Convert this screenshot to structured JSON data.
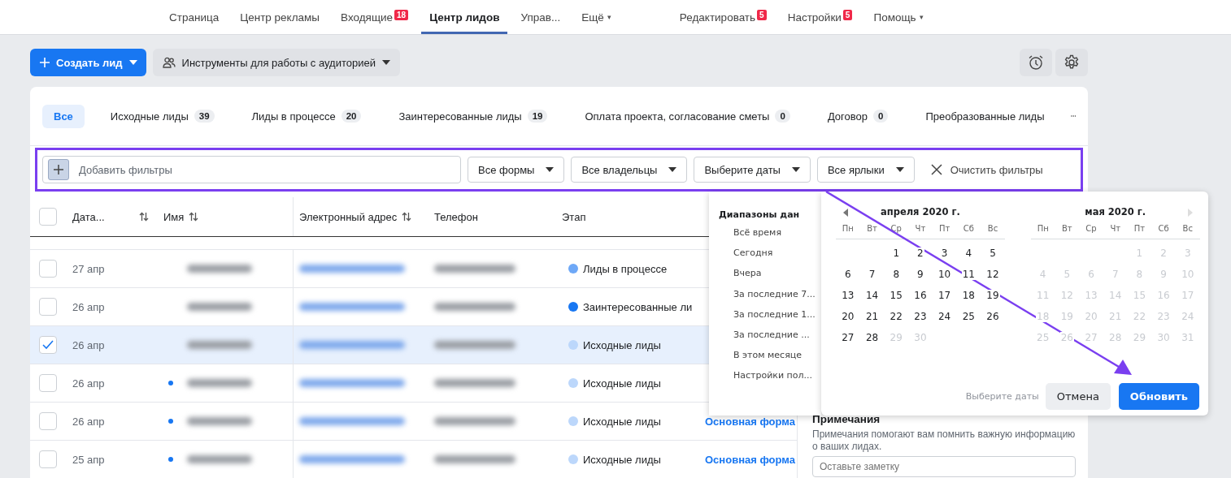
{
  "nav": {
    "left": [
      {
        "label": "Страница",
        "selected": false
      },
      {
        "label": "Центр рекламы",
        "selected": false
      },
      {
        "label": "Входящие",
        "badge": "18",
        "selected": false
      },
      {
        "label": "Центр лидов",
        "selected": true
      },
      {
        "label": "Управ...",
        "selected": false
      },
      {
        "label": "Ещё",
        "caret": "▾",
        "selected": false
      }
    ],
    "right": [
      {
        "label": "Редактировать",
        "badge": "5",
        "selected": false
      },
      {
        "label": "Настройки",
        "badge": "5",
        "selected": false
      },
      {
        "label": "Помощь",
        "caret": "▾",
        "selected": false
      }
    ]
  },
  "toolbar": {
    "create_button": "Создать лид",
    "audience_button": "Инструменты для работы с аудиторией"
  },
  "tabs": [
    {
      "label": "Все",
      "selected": true
    },
    {
      "label": "Исходные лиды",
      "count": "39",
      "selected": false
    },
    {
      "label": "Лиды в процессе",
      "count": "20",
      "selected": false
    },
    {
      "label": "Заинтересованные лиды",
      "count": "19",
      "selected": false
    },
    {
      "label": "Оплата проекта, согласование сметы",
      "count": "0",
      "selected": false
    },
    {
      "label": "Договор",
      "count": "0",
      "selected": false
    },
    {
      "label": "Преобразованные лиды",
      "selected": false
    }
  ],
  "filters": {
    "placeholder": "Добавить фильтры",
    "dropdowns": [
      "Все формы",
      "Все владельцы",
      "Выберите даты",
      "Все ярлыки"
    ],
    "clear": "Очистить фильтры"
  },
  "table": {
    "all_selected": false,
    "columns": [
      {
        "label": "Дата...",
        "sortable": true
      },
      {
        "label": "Имя",
        "sortable": true
      },
      {
        "label": "Электронный адрес",
        "sortable": true
      },
      {
        "label": "Телефон",
        "sortable": false
      },
      {
        "label": "Этап",
        "sortable": false
      }
    ],
    "rows": [
      {
        "date": "27 апр",
        "selected": false,
        "unread": false,
        "stage": "Лиды в процессе",
        "color": "#6ea8f7"
      },
      {
        "date": "26 апр",
        "selected": false,
        "unread": false,
        "stage": "Заинтересованные ли",
        "color": "#1877f2"
      },
      {
        "date": "26 апр",
        "selected": true,
        "unread": false,
        "stage": "Исходные лиды",
        "color": "#bcd7fb"
      },
      {
        "date": "26 апр",
        "selected": false,
        "unread": true,
        "stage": "Исходные лиды",
        "color": "#bcd7fb"
      },
      {
        "date": "26 апр",
        "selected": false,
        "unread": true,
        "stage": "Исходные лиды",
        "color": "#bcd7fb",
        "form": "Основная форма"
      },
      {
        "date": "25 апр",
        "selected": false,
        "unread": true,
        "stage": "Исходные лиды",
        "color": "#bcd7fb",
        "form": "Основная форма"
      }
    ]
  },
  "notes": {
    "title": "Примечания",
    "hint": "Примечания помогают вам помнить важную информацию о ваших лидах.",
    "placeholder": "Оставьте заметку"
  },
  "date_picker": {
    "ranges_title": "Диапазоны дан",
    "ranges": [
      "Всё время",
      "Сегодня",
      "Вчера",
      "За последние 7...",
      "За последние 1...",
      "За последние ...",
      "В этом месяце",
      "Настройки пол..."
    ],
    "months": [
      {
        "title": "апреля 2020 г.",
        "weekdays": [
          "Пн",
          "Вт",
          "Ср",
          "Чт",
          "Пт",
          "Сб",
          "Вс"
        ],
        "weeks": [
          [
            {
              "d": "1",
              "disabled": false
            },
            {
              "d": "2",
              "disabled": false
            },
            {
              "d": "3",
              "disabled": false
            },
            {
              "d": "4",
              "disabled": false
            },
            {
              "d": "5",
              "disabled": false
            }
          ],
          [
            {
              "d": "6",
              "disabled": false
            },
            {
              "d": "7",
              "disabled": false
            },
            {
              "d": "8",
              "disabled": false
            },
            {
              "d": "9",
              "disabled": false
            },
            {
              "d": "10",
              "disabled": false
            },
            {
              "d": "11",
              "disabled": false
            },
            {
              "d": "12",
              "disabled": false
            }
          ],
          [
            {
              "d": "13",
              "disabled": false
            },
            {
              "d": "14",
              "disabled": false
            },
            {
              "d": "15",
              "disabled": false
            },
            {
              "d": "16",
              "disabled": false
            },
            {
              "d": "17",
              "disabled": false
            },
            {
              "d": "18",
              "disabled": false
            },
            {
              "d": "19",
              "disabled": false
            }
          ],
          [
            {
              "d": "20",
              "disabled": false
            },
            {
              "d": "21",
              "disabled": false
            },
            {
              "d": "22",
              "disabled": false
            },
            {
              "d": "23",
              "disabled": false
            },
            {
              "d": "24",
              "disabled": false
            },
            {
              "d": "25",
              "disabled": false
            },
            {
              "d": "26",
              "disabled": false
            }
          ],
          [
            {
              "d": "27",
              "disabled": false
            },
            {
              "d": "28",
              "disabled": false
            },
            {
              "d": "29",
              "disabled": true
            },
            {
              "d": "30",
              "disabled": true
            }
          ]
        ]
      },
      {
        "title": "мая 2020 г.",
        "weekdays": [
          "Пн",
          "Вт",
          "Ср",
          "Чт",
          "Пт",
          "Сб",
          "Вс"
        ],
        "weeks": [
          [
            {
              "d": "1",
              "disabled": true
            },
            {
              "d": "2",
              "disabled": true
            },
            {
              "d": "3",
              "disabled": true
            }
          ],
          [
            {
              "d": "4",
              "disabled": true
            },
            {
              "d": "5",
              "disabled": true
            },
            {
              "d": "6",
              "disabled": true
            },
            {
              "d": "7",
              "disabled": true
            },
            {
              "d": "8",
              "disabled": true
            },
            {
              "d": "9",
              "disabled": true
            },
            {
              "d": "10",
              "disabled": true
            }
          ],
          [
            {
              "d": "11",
              "disabled": true
            },
            {
              "d": "12",
              "disabled": true
            },
            {
              "d": "13",
              "disabled": true
            },
            {
              "d": "14",
              "disabled": true
            },
            {
              "d": "15",
              "disabled": true
            },
            {
              "d": "16",
              "disabled": true
            },
            {
              "d": "17",
              "disabled": true
            }
          ],
          [
            {
              "d": "18",
              "disabled": true
            },
            {
              "d": "19",
              "disabled": true
            },
            {
              "d": "20",
              "disabled": true
            },
            {
              "d": "21",
              "disabled": true
            },
            {
              "d": "22",
              "disabled": true
            },
            {
              "d": "23",
              "disabled": true
            },
            {
              "d": "24",
              "disabled": true
            }
          ],
          [
            {
              "d": "25",
              "disabled": true
            },
            {
              "d": "26",
              "disabled": true
            },
            {
              "d": "27",
              "disabled": true
            },
            {
              "d": "28",
              "disabled": true
            },
            {
              "d": "29",
              "disabled": true
            },
            {
              "d": "30",
              "disabled": true
            },
            {
              "d": "31",
              "disabled": true
            }
          ]
        ]
      }
    ],
    "hint": "Выберите даты",
    "cancel": "Отмена",
    "apply": "Обновить"
  }
}
